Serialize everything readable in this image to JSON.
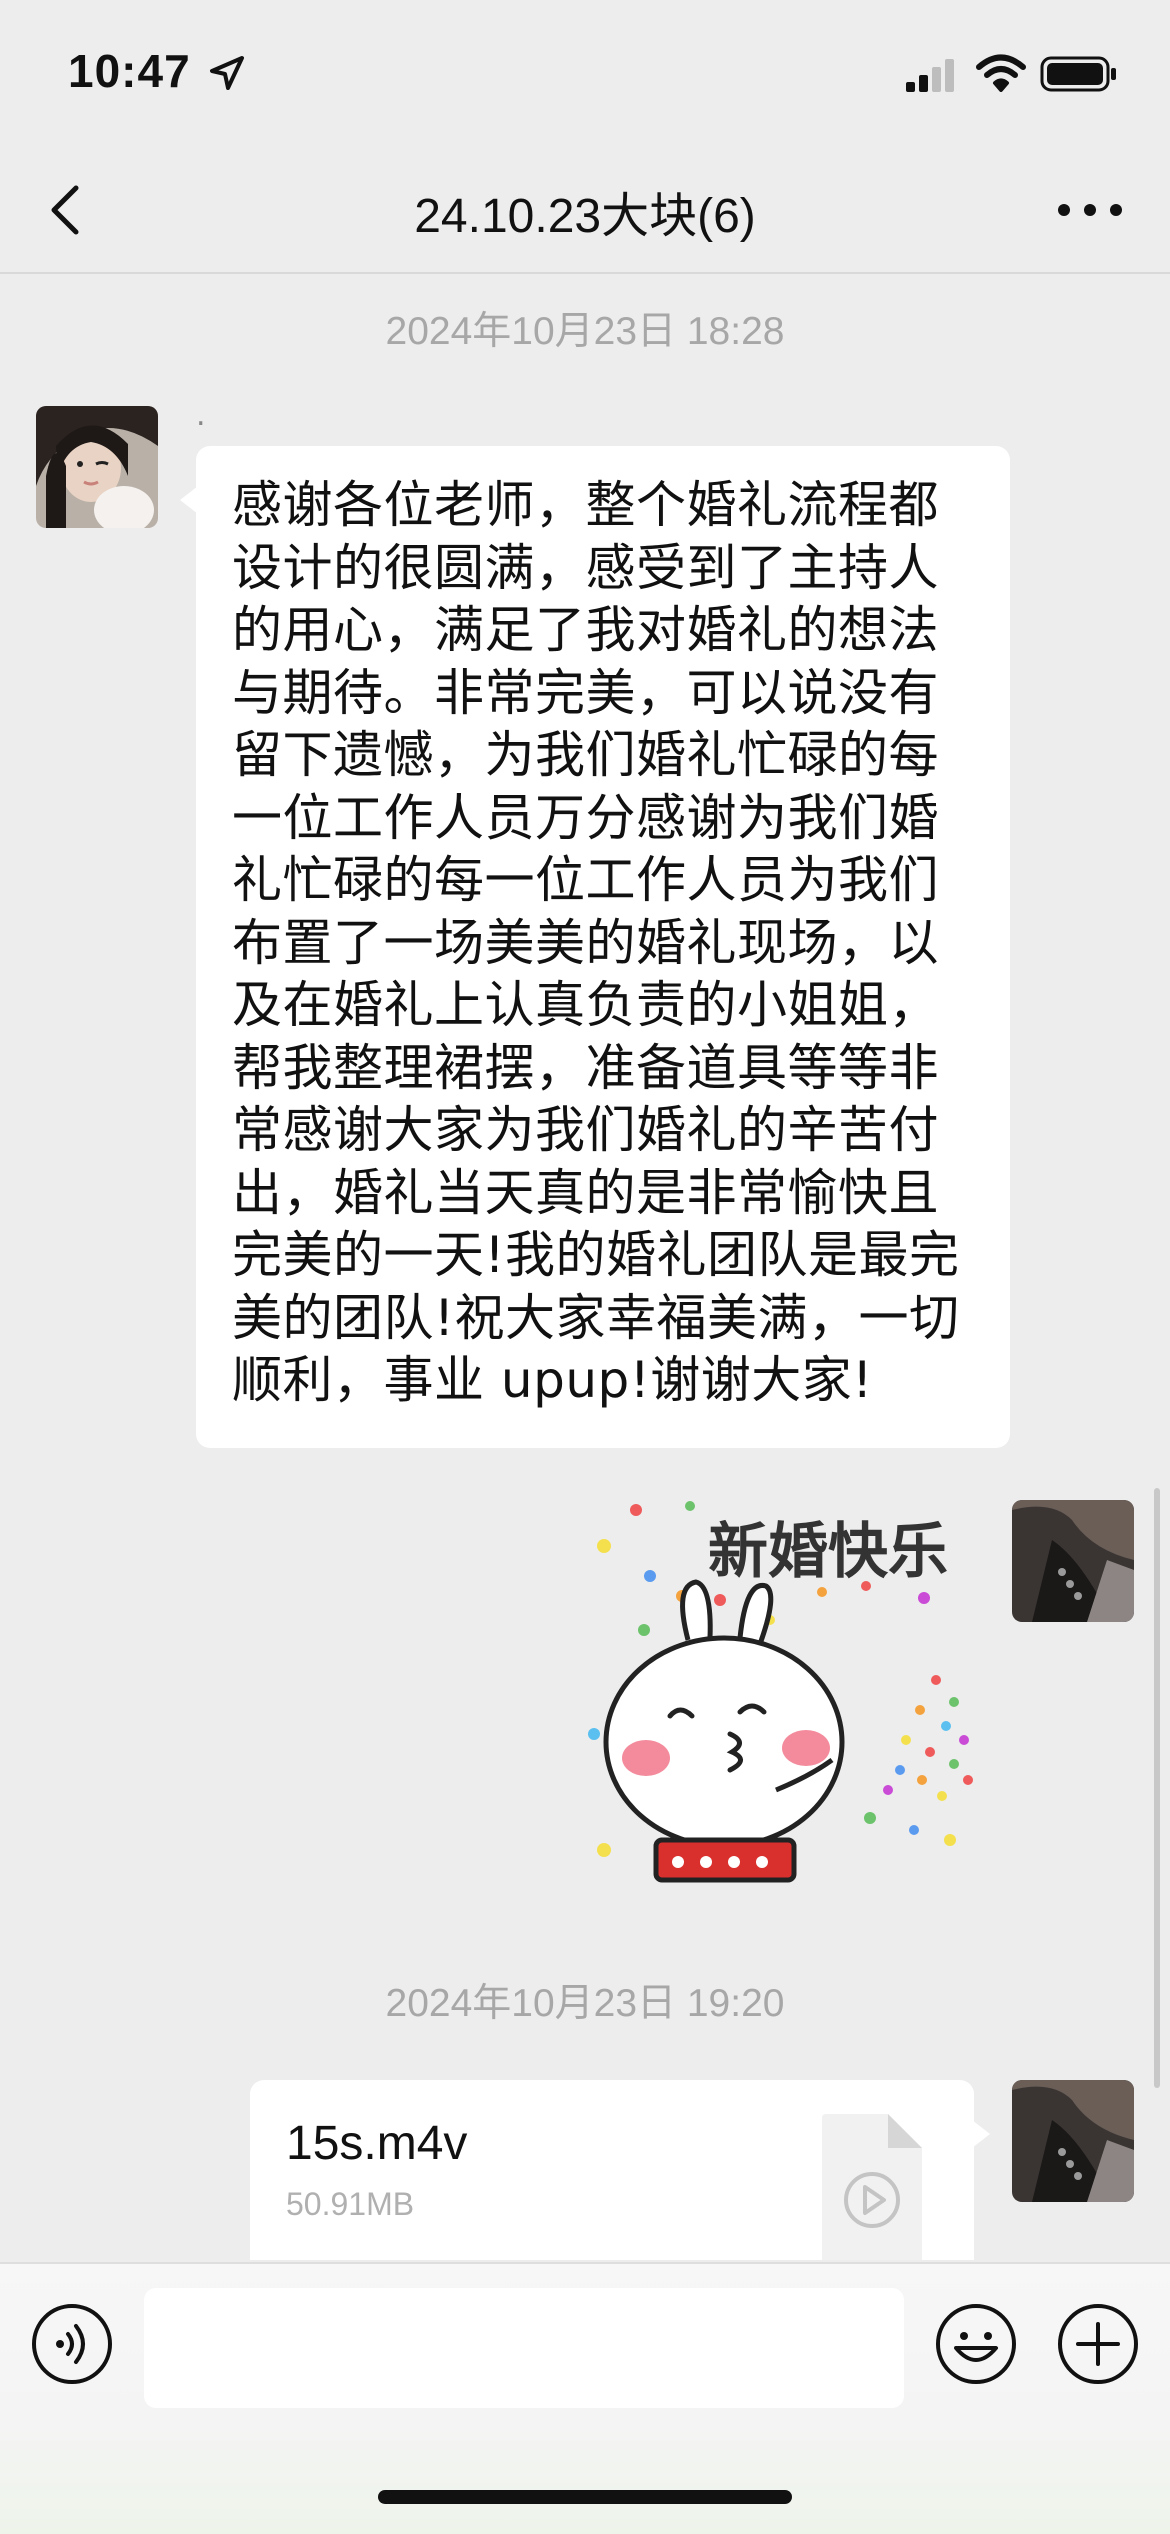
{
  "status_bar": {
    "time": "10:47"
  },
  "nav": {
    "title": "24.10.23大块(6)"
  },
  "messages": {
    "timestamp_1": "2024年10月23日 18:28",
    "sender_name": ".",
    "text_1": "感谢各位老师，整个婚礼流程都设计的很圆满，感受到了主持人的用心，满足了我对婚礼的想法与期待。非常完美，可以说没有留下遗憾，为我们婚礼忙碌的每一位工作人员万分感谢为我们婚礼忙碌的每一位工作人员为我们布置了一场美美的婚礼现场，以及在婚礼上认真负责的小姐姐，帮我整理裙摆，准备道具等等非常感谢大家为我们婚礼的辛苦付出，婚礼当天真的是非常愉快且完美的一天!我的婚礼团队是最完美的团队!祝大家幸福美满，一切顺利，事业 upup!谢谢大家!",
    "sticker_text": "新婚快乐",
    "timestamp_2": "2024年10月23日 19:20",
    "file": {
      "name": "15s.m4v",
      "size": "50.91MB"
    }
  },
  "input": {
    "placeholder": ""
  },
  "colors": {
    "background": "#ededed",
    "bubble": "#ffffff",
    "timestamp": "#a7a7a7"
  },
  "icons": [
    "location-arrow-icon",
    "signal-icon",
    "wifi-icon",
    "battery-icon",
    "back-chevron-icon",
    "more-dots-icon",
    "video-file-icon",
    "voice-icon",
    "emoji-icon",
    "plus-icon"
  ]
}
